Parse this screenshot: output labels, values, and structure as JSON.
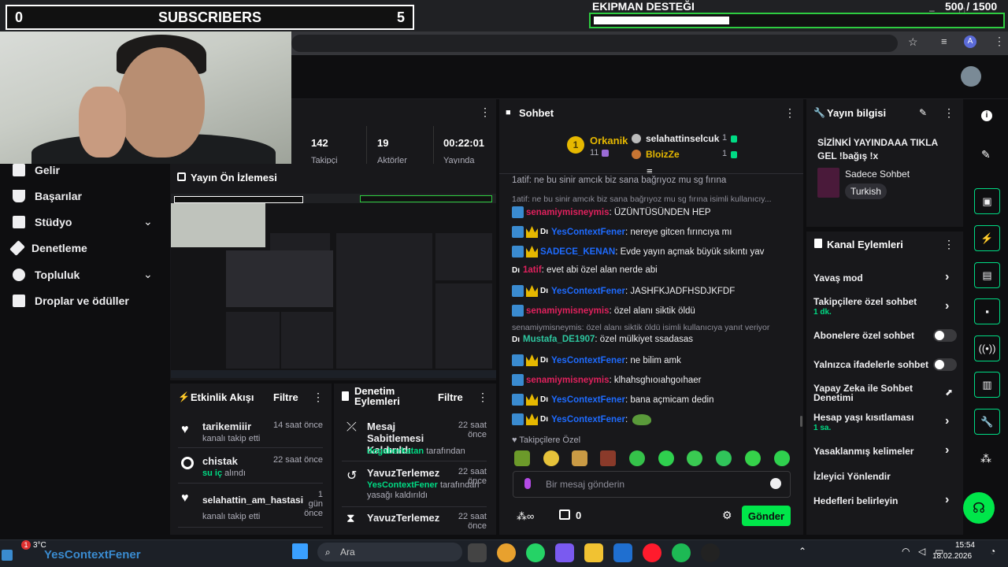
{
  "overlay": {
    "sub_left": "0",
    "sub_label": "SUBSCRIBERS",
    "sub_right": "5",
    "goal_title": "EKIPMAN DESTEĞI",
    "goal_count": "500 / 1500",
    "goal_progress": 0.333
  },
  "sidebar": {
    "items": [
      {
        "label": "Gelir"
      },
      {
        "label": "Başarılar"
      },
      {
        "label": "Stüdyo"
      },
      {
        "label": "Denetleme"
      },
      {
        "label": "Topluluk"
      },
      {
        "label": "Droplar ve ödüller"
      }
    ]
  },
  "stats": [
    {
      "value": "142",
      "label": "Takipçi"
    },
    {
      "value": "19",
      "label": "Aktörler"
    },
    {
      "value": "00:22:01",
      "label": "Yayında"
    }
  ],
  "preview": {
    "title": "Yayın Ön İzlemesi"
  },
  "activity": {
    "title": "Etkinlik Akışı",
    "filter": "Filtre",
    "items": [
      {
        "user": "tarikemiiir",
        "action": "kanalı takip etti",
        "time": "14 saat önce"
      },
      {
        "user": "chistak",
        "action_green": "su iç",
        "action": "alındı",
        "time": "22 saat önce"
      },
      {
        "user": "selahattin_am_hastasi",
        "action": "kanalı takip etti",
        "time": "1 gün önce"
      }
    ]
  },
  "moderation": {
    "title": "Denetim Eylemleri",
    "filter": "Filtre",
    "items": [
      {
        "title": "Mesaj Sabitlemesi Kaldırıldı",
        "who": "dogaberkatan",
        "suffix": "tarafından",
        "time": "22 saat önce"
      },
      {
        "title": "YavuzTerlemez",
        "who": "YesContextFener",
        "suffix": "tarafından yasağı kaldırıldı",
        "time": "22 saat önce"
      },
      {
        "title": "YavuzTerlemez",
        "time": "22 saat önce"
      }
    ]
  },
  "chat": {
    "title": "Sohbet",
    "leaders": {
      "first": {
        "name": "Orkanik",
        "count": "11"
      },
      "second": {
        "name": "selahattinselcuk",
        "count": "1"
      },
      "third": {
        "name": "BloizZe",
        "count": "1"
      }
    },
    "pinned_top": "1atif: ne bu sinir amcık biz sana bağrıyoz mu sg fırına",
    "messages": [
      {
        "reply": "1atif: ne bu sinir amcık biz sana bağrıyoz mu sg fırına isimli kullanıcıy..."
      },
      {
        "user": "senamiymisneymis",
        "color": "red",
        "text": ": ÜZÜNTÜSÜNDEN HEP"
      },
      {
        "user": "YesContextFener",
        "color": "blue",
        "text": ": nereye gitcen fırıncıya mı"
      },
      {
        "user": "SADECE_KENAN",
        "color": "blue",
        "text": ": Evde yayın açmak büyük sıkıntı yav"
      },
      {
        "user": "1atif",
        "color": "red",
        "text": ": evet abi özel alan nerde abi"
      },
      {
        "user": "YesContextFener",
        "color": "blue",
        "text": ": JASHFKJADFHSDJKFDF"
      },
      {
        "user": "senamiymisneymis",
        "color": "red",
        "text": ": özel alanı siktik öldü"
      },
      {
        "reply": "senamiymisneymis: özel alanı siktik öldü isimli kullanıcıya yanıt veriyor"
      },
      {
        "user": "Mustafa_DE1907",
        "color": "teal",
        "text": ": özel mülkiyet ssadasas"
      },
      {
        "user": "YesContextFener",
        "color": "blue",
        "text": ": ne bilim amk"
      },
      {
        "user": "senamiymisneymis",
        "color": "red",
        "text": ": klhahsghıoıahgoıhaer"
      },
      {
        "user": "YesContextFener",
        "color": "blue",
        "text": ": bana açmicam dedin"
      },
      {
        "user": "YesContextFener",
        "color": "blue",
        "text": ":"
      }
    ],
    "followers_only": "Takipçilere Özel",
    "placeholder": "Bir mesaj gönderin",
    "points": "0",
    "send": "Gönder"
  },
  "stream_info": {
    "title": "Yayın bilgisi",
    "stream_title": "SİZİNKİ YAYINDAAA TIKLA GEL !bağış !x",
    "category": "Sadece Sohbet",
    "tag": "Turkish"
  },
  "channel_actions": {
    "title": "Kanal Eylemleri",
    "items": [
      {
        "label": "Yavaş mod"
      },
      {
        "label": "Takipçilere özel sohbet",
        "sub": "1 dk."
      },
      {
        "label": "Abonelere özel sohbet"
      },
      {
        "label": "Yalnızca ifadelerle sohbet"
      },
      {
        "label": "Yapay Zeka ile Sohbet Denetimi"
      },
      {
        "label": "Hesap yaşı kısıtlaması",
        "sub": "1 sa."
      },
      {
        "label": "Yasaklanmış kelimeler"
      },
      {
        "label": "İzleyici Yönlendir"
      },
      {
        "label": "Hedefleri belirleyin"
      }
    ]
  },
  "taskbar": {
    "weather": "3°C",
    "search": "Ara",
    "time": "15:54",
    "date": "18.02.2026",
    "ticker": "YesContextFener",
    "notif": "1"
  },
  "colors": {
    "accent": "#00db84",
    "send": "#00e64a",
    "blue_user": "#1e6bff",
    "red_user": "#e0215d"
  }
}
